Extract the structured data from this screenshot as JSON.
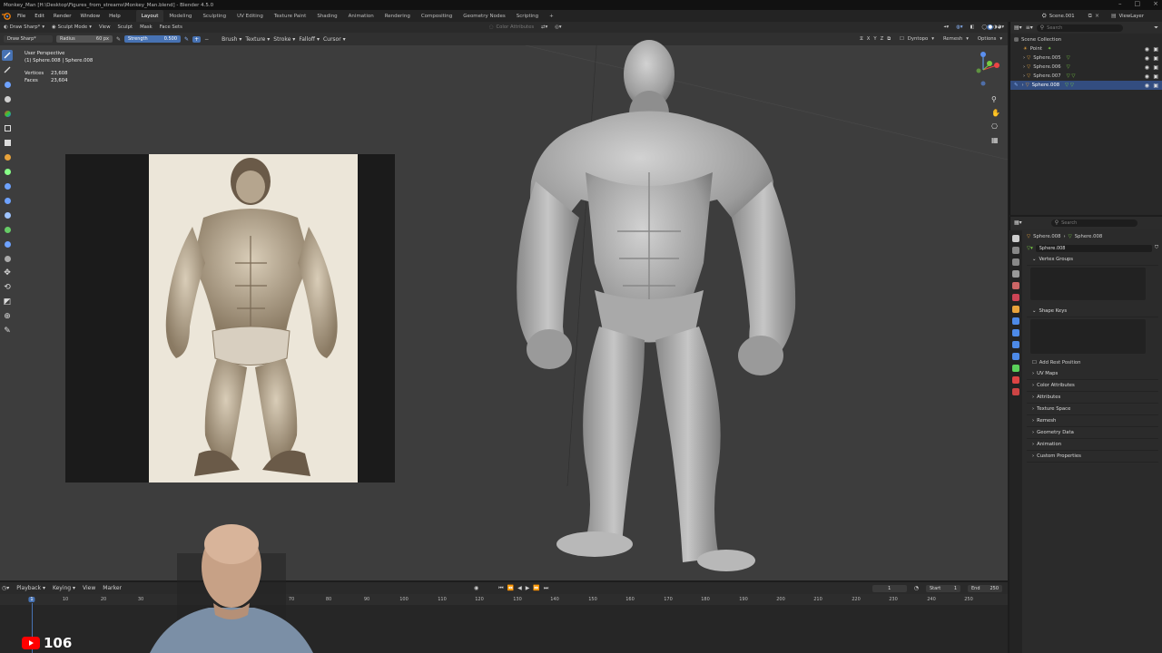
{
  "window": {
    "title": "Monkey_Man [H:\\Desktop\\Figures_from_streams\\Monkey_Man.blend] - Blender 4.5.0"
  },
  "menu": {
    "items": [
      "File",
      "Edit",
      "Render",
      "Window",
      "Help"
    ],
    "workspaces": [
      "Layout",
      "Modeling",
      "Sculpting",
      "UV Editing",
      "Texture Paint",
      "Shading",
      "Animation",
      "Rendering",
      "Compositing",
      "Geometry Nodes",
      "Scripting"
    ],
    "active_workspace": "Layout",
    "add_tab": "+",
    "scene": "Scene.001",
    "view_layer": "ViewLayer"
  },
  "viewport_header": {
    "brush": "Draw Sharp*",
    "mode": "Sculpt Mode",
    "menus": [
      "View",
      "Sculpt",
      "Mask",
      "Face Sets"
    ],
    "color_attributes": "Color Attributes",
    "dyntopo": "Dyntopo",
    "remesh": "Remesh",
    "options": "Options"
  },
  "tool_settings": {
    "radius_label": "Radius",
    "radius_value": "60 px",
    "strength_label": "Strength",
    "strength_value": "0.500",
    "menus": [
      "Brush",
      "Texture",
      "Stroke",
      "Falloff",
      "Cursor"
    ],
    "symmetry": [
      "X",
      "Y",
      "Z"
    ]
  },
  "overlay": {
    "view_name": "User Perspective",
    "object_line": "(1) Sphere.008 | Sphere.008",
    "vertices_label": "Vertices",
    "vertices_value": "23,608",
    "faces_label": "Faces",
    "faces_value": "23,604"
  },
  "outliner": {
    "search_placeholder": "Search",
    "root": "Scene Collection",
    "items": [
      {
        "name": "Point",
        "selected": false
      },
      {
        "name": "Sphere.005",
        "selected": false
      },
      {
        "name": "Sphere.006",
        "selected": false
      },
      {
        "name": "Sphere.007",
        "selected": false
      },
      {
        "name": "Sphere.008",
        "selected": true
      }
    ]
  },
  "properties": {
    "search_placeholder": "Search",
    "breadcrumb_object": "Sphere.008",
    "breadcrumb_mesh": "Sphere.008",
    "mesh_name": "Sphere.008",
    "vertex_groups": "Vertex Groups",
    "shape_keys": "Shape Keys",
    "add_rest_position": "Add Rest Position",
    "collapsed_panels": [
      "UV Maps",
      "Color Attributes",
      "Attributes",
      "Texture Space",
      "Remesh",
      "Geometry Data",
      "Animation",
      "Custom Properties"
    ]
  },
  "timeline": {
    "menus": [
      "Playback",
      "Keying",
      "View",
      "Marker"
    ],
    "current_frame": "1",
    "start_label": "Start",
    "start_value": "1",
    "end_label": "End",
    "end_value": "250",
    "ticks": [
      "1",
      "10",
      "20",
      "30",
      "70",
      "80",
      "90",
      "100",
      "110",
      "120",
      "130",
      "140",
      "150",
      "160",
      "170",
      "180",
      "190",
      "200",
      "210",
      "220",
      "230",
      "240",
      "250"
    ]
  },
  "overlay_badge": {
    "count": "106"
  },
  "colors": {
    "accent_blue": "#4772b3",
    "viewport_bg": "#3d3d3d",
    "selected_row": "#334d80",
    "youtube_red": "#ff0000"
  }
}
